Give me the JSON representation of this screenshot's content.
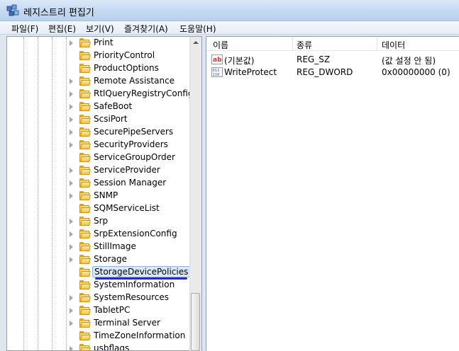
{
  "window": {
    "title": "레지스트리 편집기"
  },
  "menu": [
    "파일(F)",
    "편집(E)",
    "보기(V)",
    "즐겨찾기(A)",
    "도움말(H)"
  ],
  "tree": {
    "items": [
      "Print",
      "PriorityControl",
      "ProductOptions",
      "Remote Assistance",
      "RtlQueryRegistryConfig",
      "SafeBoot",
      "ScsiPort",
      "SecurePipeServers",
      "SecurityProviders",
      "ServiceGroupOrder",
      "ServiceProvider",
      "Session Manager",
      "SNMP",
      "SQMServiceList",
      "Srp",
      "SrpExtensionConfig",
      "StillImage",
      "Storage",
      "StorageDevicePolicies",
      "SystemInformation",
      "SystemResources",
      "TabletPC",
      "Terminal Server",
      "TimeZoneInformation",
      "usbflags"
    ],
    "expandable": [
      true,
      false,
      false,
      true,
      true,
      true,
      true,
      true,
      true,
      false,
      true,
      true,
      true,
      false,
      true,
      true,
      true,
      true,
      false,
      false,
      true,
      true,
      true,
      false,
      true
    ],
    "selected": "StorageDevicePolicies"
  },
  "list": {
    "columns": {
      "name": "이름",
      "type": "종류",
      "data": "데이터"
    },
    "rows": [
      {
        "icon": "string-value-icon",
        "name": "(기본값)",
        "type": "REG_SZ",
        "data": "(값 설정 안 됨)"
      },
      {
        "icon": "dword-value-icon",
        "name": "WriteProtect",
        "type": "REG_DWORD",
        "data": "0x00000000 (0)"
      }
    ]
  },
  "colors": {
    "selection_underline": "#2732a9",
    "folder": "#f0c44a"
  }
}
